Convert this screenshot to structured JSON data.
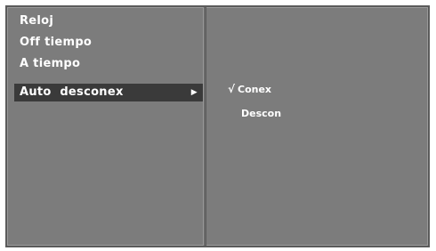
{
  "menu": {
    "items": [
      {
        "label": "Reloj"
      },
      {
        "label": "Off tiempo"
      },
      {
        "label": "A tiempo"
      },
      {
        "label": "Auto  desconex",
        "selected": true
      }
    ],
    "submenu_arrow_icon": "right-triangle-icon"
  },
  "submenu": {
    "options": [
      {
        "label": "Conex",
        "checked": true,
        "check_mark": "√"
      },
      {
        "label": "Descon",
        "checked": false
      }
    ]
  },
  "colors": {
    "panel": "#7c7c7c",
    "highlight": "#3a3a3a",
    "text": "#ffffff"
  }
}
